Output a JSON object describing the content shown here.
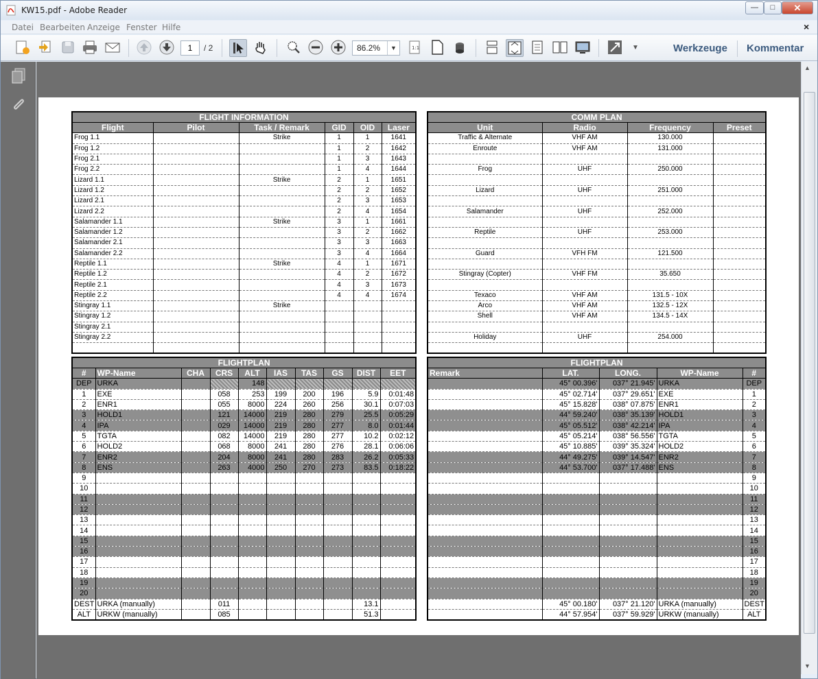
{
  "window": {
    "title": "KW15.pdf - Adobe Reader",
    "min_glyph": "—",
    "max_glyph": "□",
    "close_glyph": "✕"
  },
  "menu": {
    "items": [
      "Datei",
      "Bearbeiten",
      "Anzeige",
      "Fenster",
      "Hilfe"
    ],
    "close_glyph": "×"
  },
  "toolbar": {
    "page_current": "1",
    "page_total": "/ 2",
    "zoom": "86.2%",
    "werkzeuge": "Werkzeuge",
    "kommentar": "Kommentar"
  },
  "flight_info": {
    "title": "FLIGHT INFORMATION",
    "headers": [
      "Flight",
      "Pilot",
      "Task / Remark",
      "GID",
      "OID",
      "Laser"
    ],
    "rows": [
      [
        "Frog 1.1",
        "",
        "Strike",
        "1",
        "1",
        "1641"
      ],
      [
        "Frog 1.2",
        "",
        "",
        "1",
        "2",
        "1642"
      ],
      [
        "Frog 2.1",
        "",
        "",
        "1",
        "3",
        "1643"
      ],
      [
        "Frog 2.2",
        "",
        "",
        "1",
        "4",
        "1644"
      ],
      [
        "Lizard 1.1",
        "",
        "Strike",
        "2",
        "1",
        "1651"
      ],
      [
        "Lizard 1.2",
        "",
        "",
        "2",
        "2",
        "1652"
      ],
      [
        "Lizard 2.1",
        "",
        "",
        "2",
        "3",
        "1653"
      ],
      [
        "Lizard 2.2",
        "",
        "",
        "2",
        "4",
        "1654"
      ],
      [
        "Salamander 1.1",
        "",
        "Strike",
        "3",
        "1",
        "1661"
      ],
      [
        "Salamander 1.2",
        "",
        "",
        "3",
        "2",
        "1662"
      ],
      [
        "Salamander 2.1",
        "",
        "",
        "3",
        "3",
        "1663"
      ],
      [
        "Salamander 2.2",
        "",
        "",
        "3",
        "4",
        "1664"
      ],
      [
        "Reptile 1.1",
        "",
        "Strike",
        "4",
        "1",
        "1671"
      ],
      [
        "Reptile 1.2",
        "",
        "",
        "4",
        "2",
        "1672"
      ],
      [
        "Reptile 2.1",
        "",
        "",
        "4",
        "3",
        "1673"
      ],
      [
        "Reptile 2.2",
        "",
        "",
        "4",
        "4",
        "1674"
      ],
      [
        "Stingray 1.1",
        "",
        "Strike",
        "",
        "",
        ""
      ],
      [
        "Stingray 1.2",
        "",
        "",
        "",
        "",
        ""
      ],
      [
        "Stingray 2.1",
        "",
        "",
        "",
        "",
        ""
      ],
      [
        "Stingray 2.2",
        "",
        "",
        "",
        "",
        ""
      ],
      [
        "",
        "",
        "",
        "",
        "",
        ""
      ]
    ]
  },
  "comm_plan": {
    "title": "COMM PLAN",
    "headers": [
      "Unit",
      "Radio",
      "Frequency",
      "Preset"
    ],
    "rows": [
      [
        "Traffic & Alternate",
        "VHF AM",
        "130.000",
        ""
      ],
      [
        "Enroute",
        "VHF AM",
        "131.000",
        ""
      ],
      [
        "",
        "",
        "",
        ""
      ],
      [
        "Frog",
        "UHF",
        "250.000",
        ""
      ],
      [
        "",
        "",
        "",
        ""
      ],
      [
        "Lizard",
        "UHF",
        "251.000",
        ""
      ],
      [
        "",
        "",
        "",
        ""
      ],
      [
        "Salamander",
        "UHF",
        "252.000",
        ""
      ],
      [
        "",
        "",
        "",
        ""
      ],
      [
        "Reptile",
        "UHF",
        "253.000",
        ""
      ],
      [
        "",
        "",
        "",
        ""
      ],
      [
        "Guard",
        "VFH FM",
        "121.500",
        ""
      ],
      [
        "",
        "",
        "",
        ""
      ],
      [
        "Stingray (Copter)",
        "VHF FM",
        "35.650",
        ""
      ],
      [
        "",
        "",
        "",
        ""
      ],
      [
        "Texaco",
        "VHF AM",
        "131.5 - 10X",
        ""
      ],
      [
        "Arco",
        "VHF AM",
        "132.5 - 12X",
        ""
      ],
      [
        "Shell",
        "VHF AM",
        "134.5 - 14X",
        ""
      ],
      [
        "",
        "",
        "",
        ""
      ],
      [
        "Holiday",
        "UHF",
        "254.000",
        ""
      ],
      [
        "",
        "",
        "",
        ""
      ]
    ]
  },
  "flightplan_left": {
    "title": "FLIGHTPLAN",
    "headers": [
      "#",
      "WP-Name",
      "CHA",
      "CRS",
      "ALT",
      "IAS",
      "TAS",
      "GS",
      "DIST",
      "EET"
    ],
    "rows": [
      [
        "DEP",
        "URKA",
        "",
        "",
        "148",
        "",
        "",
        "",
        "",
        ""
      ],
      [
        "1",
        "EXE",
        "",
        "058",
        "253",
        "199",
        "200",
        "196",
        "5.9",
        "0:01:48"
      ],
      [
        "2",
        "ENR1",
        "",
        "055",
        "8000",
        "224",
        "260",
        "256",
        "30.1",
        "0:07:03"
      ],
      [
        "3",
        "HOLD1",
        "",
        "121",
        "14000",
        "219",
        "280",
        "279",
        "25.5",
        "0:05:29"
      ],
      [
        "4",
        "IPA",
        "",
        "029",
        "14000",
        "219",
        "280",
        "277",
        "8.0",
        "0:01:44"
      ],
      [
        "5",
        "TGTA",
        "",
        "082",
        "14000",
        "219",
        "280",
        "277",
        "10.2",
        "0:02:12"
      ],
      [
        "6",
        "HOLD2",
        "",
        "068",
        "8000",
        "241",
        "280",
        "276",
        "28.1",
        "0:06:06"
      ],
      [
        "7",
        "ENR2",
        "",
        "204",
        "8000",
        "241",
        "280",
        "283",
        "26.2",
        "0:05:33"
      ],
      [
        "8",
        "ENS",
        "",
        "263",
        "4000",
        "250",
        "270",
        "273",
        "83.5",
        "0:18:22"
      ],
      [
        "9",
        "",
        "",
        "",
        "",
        "",
        "",
        "",
        "",
        ""
      ],
      [
        "10",
        "",
        "",
        "",
        "",
        "",
        "",
        "",
        "",
        ""
      ],
      [
        "11",
        "",
        "",
        "",
        "",
        "",
        "",
        "",
        "",
        ""
      ],
      [
        "12",
        "",
        "",
        "",
        "",
        "",
        "",
        "",
        "",
        ""
      ],
      [
        "13",
        "",
        "",
        "",
        "",
        "",
        "",
        "",
        "",
        ""
      ],
      [
        "14",
        "",
        "",
        "",
        "",
        "",
        "",
        "",
        "",
        ""
      ],
      [
        "15",
        "",
        "",
        "",
        "",
        "",
        "",
        "",
        "",
        ""
      ],
      [
        "16",
        "",
        "",
        "",
        "",
        "",
        "",
        "",
        "",
        ""
      ],
      [
        "17",
        "",
        "",
        "",
        "",
        "",
        "",
        "",
        "",
        ""
      ],
      [
        "18",
        "",
        "",
        "",
        "",
        "",
        "",
        "",
        "",
        ""
      ],
      [
        "19",
        "",
        "",
        "",
        "",
        "",
        "",
        "",
        "",
        ""
      ],
      [
        "20",
        "",
        "",
        "",
        "",
        "",
        "",
        "",
        "",
        ""
      ],
      [
        "DEST",
        "URKA (manually)",
        "",
        "011",
        "",
        "",
        "",
        "",
        "13.1",
        ""
      ],
      [
        "ALT",
        "URKW (manually)",
        "",
        "085",
        "",
        "",
        "",
        "",
        "51.3",
        ""
      ]
    ]
  },
  "flightplan_right": {
    "title": "FLIGHTPLAN",
    "headers": [
      "Remark",
      "LAT.",
      "LONG.",
      "WP-Name",
      "#"
    ],
    "rows": [
      [
        "",
        "45° 00.396'",
        "037° 21.945'",
        "URKA",
        "DEP"
      ],
      [
        "",
        "45° 02.714'",
        "037° 29.651'",
        "EXE",
        "1"
      ],
      [
        "",
        "45° 15.828'",
        "038° 07.875'",
        "ENR1",
        "2"
      ],
      [
        "",
        "44° 59.240'",
        "038° 35.139'",
        "HOLD1",
        "3"
      ],
      [
        "",
        "45° 05.512'",
        "038° 42.214'",
        "IPA",
        "4"
      ],
      [
        "",
        "45° 05.214'",
        "038° 56.556'",
        "TGTA",
        "5"
      ],
      [
        "",
        "45° 10.885'",
        "039° 35.324'",
        "HOLD2",
        "6"
      ],
      [
        "",
        "44° 49.275'",
        "039° 14.547'",
        "ENR2",
        "7"
      ],
      [
        "",
        "44° 53.700'",
        "037° 17.488'",
        "ENS",
        "8"
      ],
      [
        "",
        "",
        "",
        "",
        "9"
      ],
      [
        "",
        "",
        "",
        "",
        "10"
      ],
      [
        "",
        "",
        "",
        "",
        "11"
      ],
      [
        "",
        "",
        "",
        "",
        "12"
      ],
      [
        "",
        "",
        "",
        "",
        "13"
      ],
      [
        "",
        "",
        "",
        "",
        "14"
      ],
      [
        "",
        "",
        "",
        "",
        "15"
      ],
      [
        "",
        "",
        "",
        "",
        "16"
      ],
      [
        "",
        "",
        "",
        "",
        "17"
      ],
      [
        "",
        "",
        "",
        "",
        "18"
      ],
      [
        "",
        "",
        "",
        "",
        "19"
      ],
      [
        "",
        "",
        "",
        "",
        "20"
      ],
      [
        "",
        "45° 00.180'",
        "037° 21.120'",
        "URKA (manually)",
        "DEST"
      ],
      [
        "",
        "44° 57.954'",
        "037° 59.929'",
        "URKW (manually)",
        "ALT"
      ]
    ]
  },
  "gray_rows": [
    0,
    3,
    4,
    7,
    8,
    11,
    12,
    15,
    16,
    19,
    20
  ]
}
